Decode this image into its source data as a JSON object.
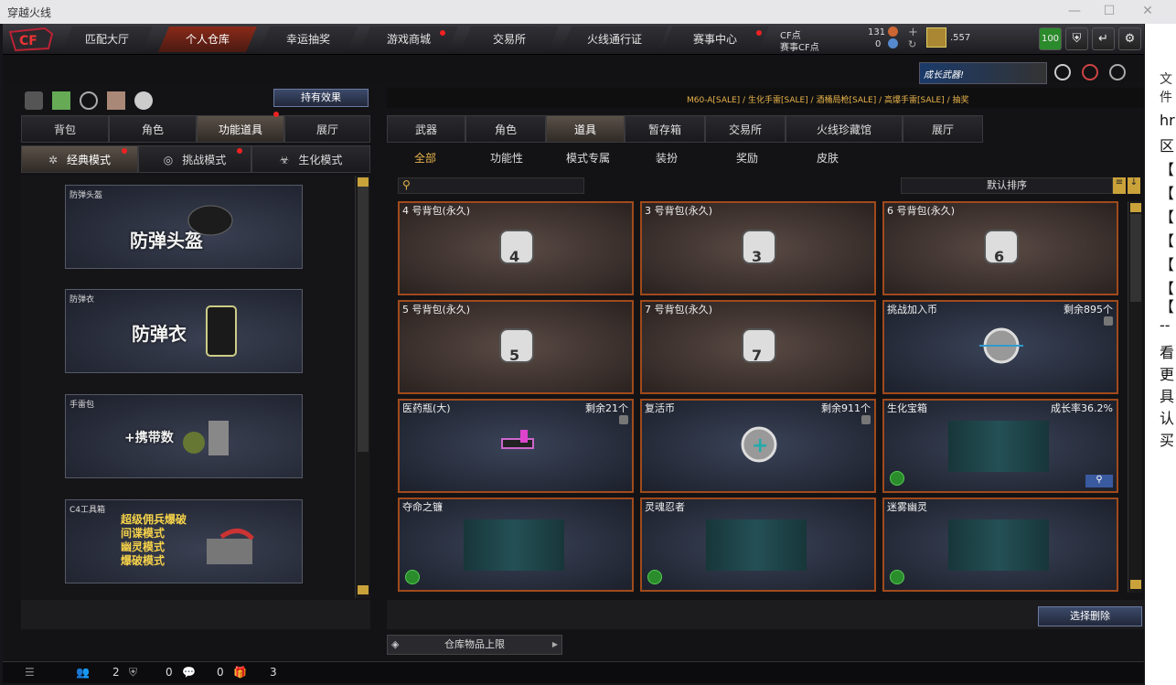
{
  "window": {
    "title": "穿越火线"
  },
  "nav": {
    "items": [
      "匹配大厅",
      "个人仓库",
      "幸运抽奖",
      "游戏商城",
      "交易所",
      "火线通行证",
      "赛事中心"
    ]
  },
  "cf": {
    "cf_label": "CF点",
    "cf_value": "131",
    "event_label": "赛事CF点",
    "event_value": "0",
    "coins": ".557",
    "level": "100"
  },
  "banner": {
    "text": "成长武器!"
  },
  "ticker": {
    "text": "M60-A[SALE] / 生化手雷[SALE] / 酒桶局枪[SALE] / 高爆手雷[SALE] / 抽奖"
  },
  "left": {
    "effect_button": "持有效果",
    "tabs": [
      "背包",
      "角色",
      "功能道具",
      "展厅"
    ],
    "modes": [
      "经典模式",
      "挑战模式",
      "生化模式"
    ],
    "cards": [
      {
        "label": "防弹头盔",
        "big": "防弹头盔"
      },
      {
        "label": "防弹衣",
        "big": "防弹衣"
      },
      {
        "label": "手雷包",
        "big": "+携带数"
      },
      {
        "label": "C4工具箱",
        "lines": [
          "超级佣兵爆破",
          "间谍模式",
          "幽灵模式",
          "爆破模式"
        ]
      }
    ]
  },
  "right": {
    "tabs": [
      "武器",
      "角色",
      "道具",
      "暂存箱",
      "交易所",
      "火线珍藏馆",
      "展厅"
    ],
    "subtabs": [
      "全部",
      "功能性",
      "模式专属",
      "装扮",
      "奖励",
      "皮肤"
    ],
    "search_placeholder": "",
    "sort": "默认排序",
    "items": [
      {
        "name": "4 号背包(永久)",
        "right": "",
        "bag": "4"
      },
      {
        "name": "3 号背包(永久)",
        "right": "",
        "bag": "3"
      },
      {
        "name": "6 号背包(永久)",
        "right": "",
        "bag": "6"
      },
      {
        "name": "5 号背包(永久)",
        "right": "",
        "bag": "5"
      },
      {
        "name": "7 号背包(永久)",
        "right": "",
        "bag": "7"
      },
      {
        "name": "挑战加入币",
        "right": "剩余895个",
        "bag": ""
      },
      {
        "name": "医药瓶(大)",
        "right": "剩余21个",
        "bag": ""
      },
      {
        "name": "复活币",
        "right": "剩余911个",
        "bag": ""
      },
      {
        "name": "生化宝箱",
        "right": "成长率36.2%",
        "bag": ""
      },
      {
        "name": "夺命之镰",
        "right": "",
        "bag": ""
      },
      {
        "name": "灵魂忍者",
        "right": "",
        "bag": ""
      },
      {
        "name": "迷雾幽灵",
        "right": "",
        "bag": ""
      }
    ],
    "delete_button": "选择删除",
    "storage_limit": "仓库物品上限"
  },
  "bottom": {
    "a": "2",
    "b": "0",
    "c": "0",
    "d": "3"
  },
  "sidebar": {
    "lines": [
      "文件",
      "hr",
      "区",
      "【",
      "【",
      "【",
      "【",
      "【",
      "【",
      "【",
      "--",
      "看",
      "更",
      "具",
      "认",
      "买"
    ]
  }
}
